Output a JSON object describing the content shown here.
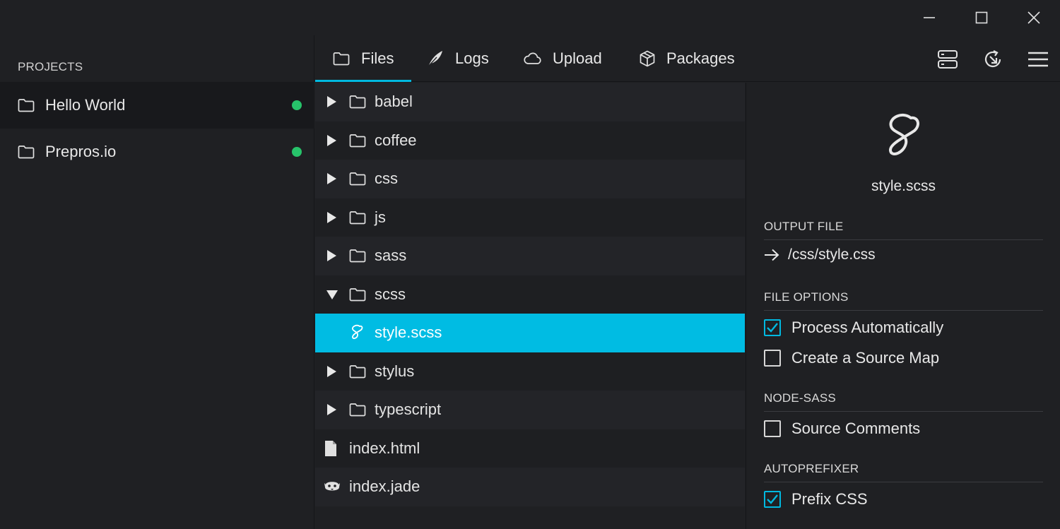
{
  "sidebar": {
    "heading": "PROJECTS",
    "projects": [
      {
        "name": "Hello World",
        "status": "active"
      },
      {
        "name": "Prepros.io",
        "status": "active"
      }
    ]
  },
  "tabs": [
    {
      "label": "Files",
      "icon": "folder-icon"
    },
    {
      "label": "Logs",
      "icon": "feather-icon"
    },
    {
      "label": "Upload",
      "icon": "cloud-icon"
    },
    {
      "label": "Packages",
      "icon": "package-icon"
    }
  ],
  "toolbar": {
    "icons": [
      "server-icon",
      "refresh-icon",
      "menu-icon"
    ]
  },
  "files": [
    {
      "name": "babel",
      "type": "folder",
      "expanded": false
    },
    {
      "name": "coffee",
      "type": "folder",
      "expanded": false
    },
    {
      "name": "css",
      "type": "folder",
      "expanded": false
    },
    {
      "name": "js",
      "type": "folder",
      "expanded": false
    },
    {
      "name": "sass",
      "type": "folder",
      "expanded": false
    },
    {
      "name": "scss",
      "type": "folder",
      "expanded": true
    },
    {
      "name": "style.scss",
      "type": "sass-file",
      "selected": true
    },
    {
      "name": "stylus",
      "type": "folder",
      "expanded": false
    },
    {
      "name": "typescript",
      "type": "folder",
      "expanded": false
    },
    {
      "name": "index.html",
      "type": "file"
    },
    {
      "name": "index.jade",
      "type": "jade-file"
    }
  ],
  "panel": {
    "filename": "style.scss",
    "output_file_title": "OUTPUT FILE",
    "output_path": "/css/style.css",
    "file_options_title": "FILE OPTIONS",
    "file_options": [
      {
        "label": "Process Automatically",
        "checked": true
      },
      {
        "label": "Create a Source Map",
        "checked": false
      }
    ],
    "node_sass_title": "NODE-SASS",
    "node_sass_options": [
      {
        "label": "Source Comments",
        "checked": false
      }
    ],
    "autoprefixer_title": "AUTOPREFIXER",
    "autoprefixer_options": [
      {
        "label": "Prefix CSS",
        "checked": true
      }
    ]
  },
  "colors": {
    "accent": "#00b9e0",
    "status_green": "#27c36a",
    "background": "#1f2023"
  }
}
